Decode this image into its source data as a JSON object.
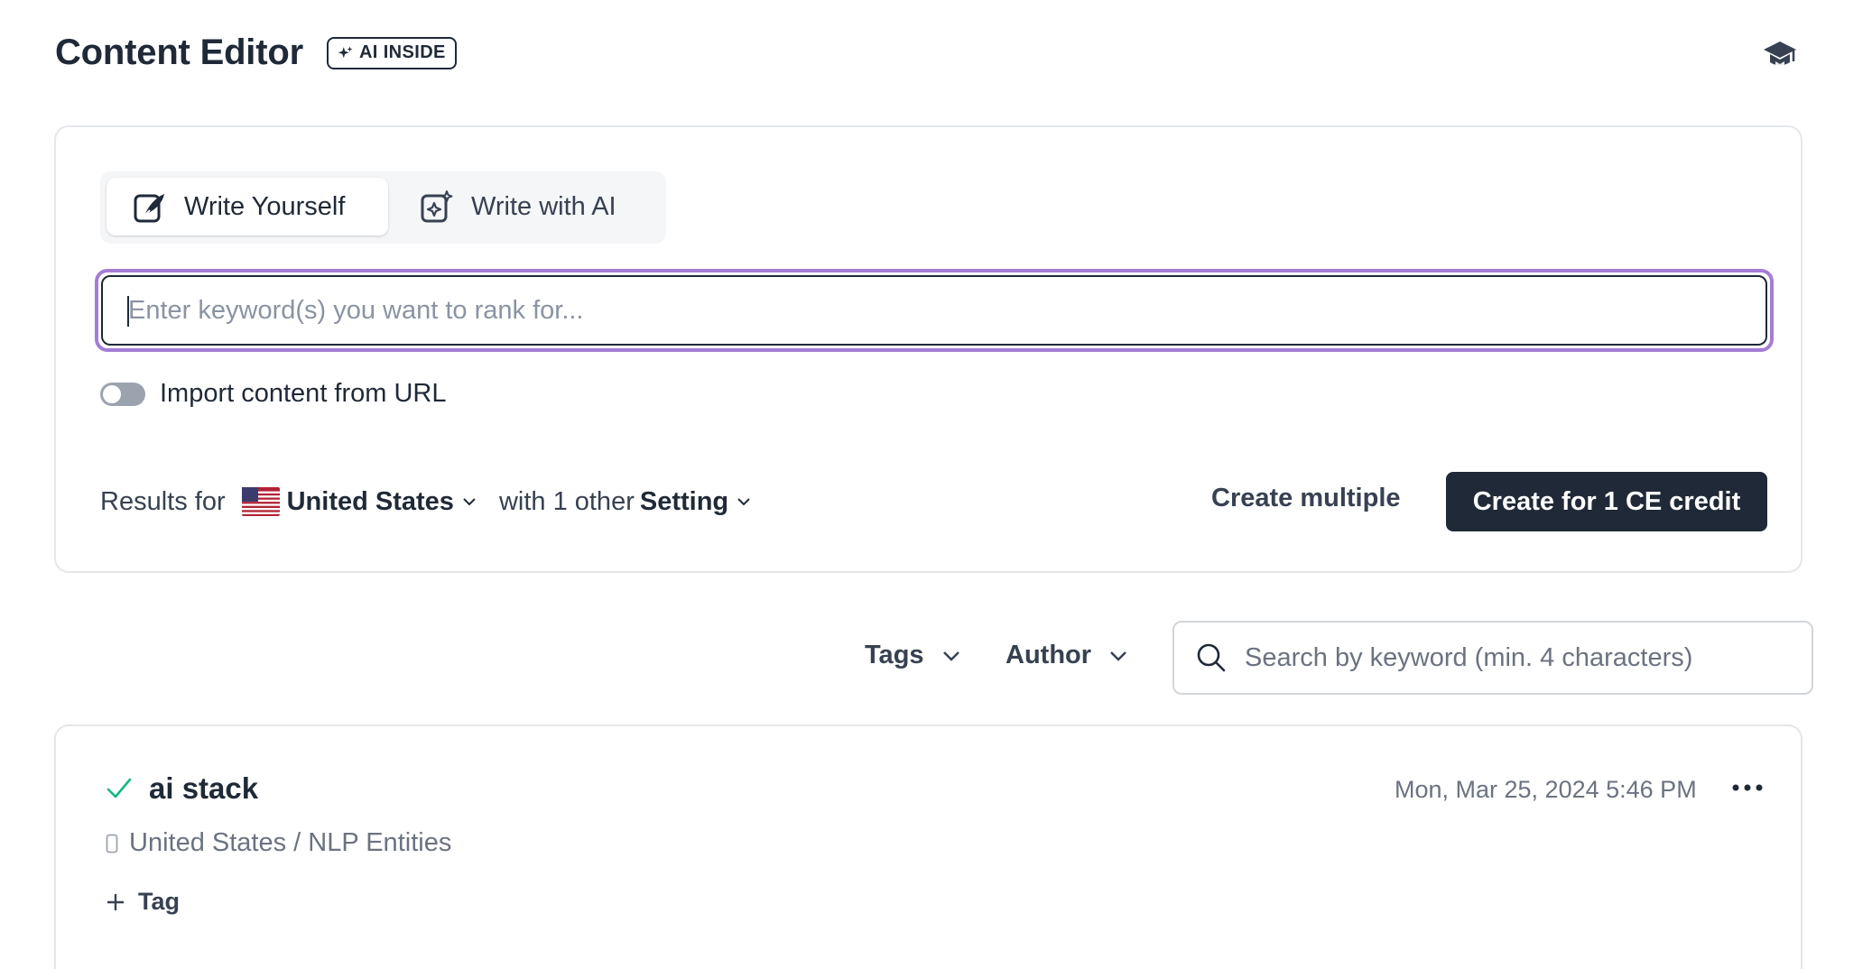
{
  "header": {
    "title": "Content Editor",
    "ai_badge": "AI INSIDE"
  },
  "create": {
    "tabs": [
      {
        "label": "Write Yourself",
        "icon": "pen-note-icon",
        "active": true
      },
      {
        "label": "Write with AI",
        "icon": "sparkle-note-icon",
        "active": false
      }
    ],
    "keyword_placeholder": "Enter keyword(s) you want to rank for...",
    "keyword_value": "",
    "import_toggle": {
      "label": "Import content from URL",
      "on": false
    },
    "results_for_label": "Results for",
    "country": "United States",
    "with_other_label": "with 1 other",
    "setting_label": "Setting",
    "create_multiple_label": "Create multiple",
    "create_button_label": "Create for 1 CE credit"
  },
  "filters": {
    "tags_label": "Tags",
    "author_label": "Author",
    "search_placeholder": "Search by keyword (min. 4 characters)"
  },
  "items": [
    {
      "title": "ai stack",
      "status": "done",
      "meta": "United States / NLP Entities",
      "date": "Mon, Mar 25, 2024 5:46 PM",
      "add_tag_label": "Tag"
    }
  ],
  "colors": {
    "primary": "#1f2937",
    "focus_ring": "#a47dd6",
    "success": "#10b981",
    "muted": "#6b7280"
  }
}
